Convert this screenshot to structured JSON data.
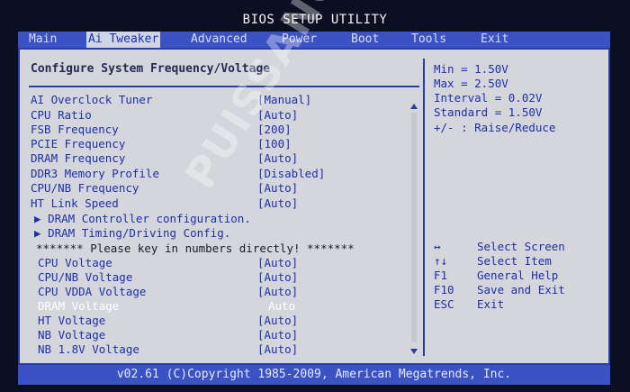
{
  "title": "BIOS SETUP UTILITY",
  "menu": [
    {
      "label": "Main",
      "active": false
    },
    {
      "label": "Ai Tweaker",
      "active": true
    },
    {
      "label": "Advanced",
      "active": false
    },
    {
      "label": "Power",
      "active": false
    },
    {
      "label": "Boot",
      "active": false
    },
    {
      "label": "Tools",
      "active": false
    },
    {
      "label": "Exit",
      "active": false
    }
  ],
  "section_title": "Configure System Frequency/Voltage",
  "settings": [
    {
      "label": "AI Overclock Tuner",
      "value": "[Manual]"
    },
    {
      "label": "CPU Ratio",
      "value": "[Auto]"
    },
    {
      "label": "FSB Frequency",
      "value": "[200]"
    },
    {
      "label": "PCIE Frequency",
      "value": "[100]"
    },
    {
      "label": "DRAM Frequency",
      "value": "[Auto]"
    },
    {
      "label": "DDR3 Memory Profile",
      "value": "[Disabled]"
    },
    {
      "label": "CPU/NB Frequency",
      "value": "[Auto]"
    },
    {
      "label": "HT Link Speed",
      "value": "[Auto]"
    }
  ],
  "submenus": [
    {
      "label": "DRAM Controller configuration."
    },
    {
      "label": "DRAM Timing/Driving Config."
    }
  ],
  "notice": "******* Please key in numbers directly! *******",
  "voltages": [
    {
      "label": "CPU Voltage",
      "value": "[Auto]"
    },
    {
      "label": "CPU/NB Voltage",
      "value": "[Auto]"
    },
    {
      "label": "CPU VDDA Voltage",
      "value": "[Auto]"
    },
    {
      "label": "DRAM Voltage",
      "value": "Auto",
      "selected": true
    },
    {
      "label": "HT Voltage",
      "value": "[Auto]"
    },
    {
      "label": "NB Voltage",
      "value": "[Auto]"
    },
    {
      "label": "NB 1.8V Voltage",
      "value": "[Auto]"
    }
  ],
  "help": {
    "min": "Min = 1.50V",
    "max": "Max = 2.50V",
    "interval": "Interval = 0.02V",
    "standard": "Standard = 1.50V",
    "adjust": "+/- : Raise/Reduce"
  },
  "keys": [
    {
      "key": "↔",
      "desc": "Select Screen"
    },
    {
      "key": "↑↓",
      "desc": "Select Item"
    },
    {
      "key": "F1",
      "desc": "General Help"
    },
    {
      "key": "F10",
      "desc": "Save and Exit"
    },
    {
      "key": "ESC",
      "desc": "Exit"
    }
  ],
  "footer": "v02.61 (C)Copyright 1985-2009, American Megatrends, Inc.",
  "watermark": "PUISSANCE-PC",
  "colors": {
    "menubar": "#3b52c4",
    "panel": "#d4d6db",
    "text_blue": "#1e2fa8",
    "border": "#2a3da0"
  }
}
